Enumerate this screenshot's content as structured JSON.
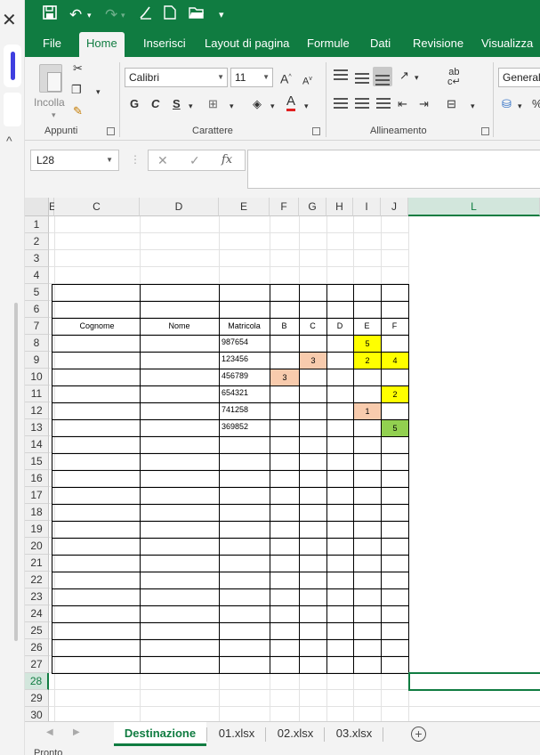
{
  "titlebar": {
    "more_label": "▾"
  },
  "tabs": [
    "File",
    "Home",
    "Inserisci",
    "Layout di pagina",
    "Formule",
    "Dati",
    "Revisione",
    "Visualizza"
  ],
  "ribbon": {
    "paste_label": "Incolla",
    "font_name": "Calibri",
    "font_size": "11",
    "number_format": "Generale",
    "groups": [
      "Appunti",
      "Carattere",
      "Allineamento"
    ]
  },
  "formula_bar": {
    "name_box": "L28",
    "fx_label": "fx",
    "formula": ""
  },
  "columns": [
    "E",
    "C",
    "D",
    "E",
    "F",
    "G",
    "H",
    "I",
    "J",
    "L"
  ],
  "rows": [
    "1",
    "2",
    "3",
    "4",
    "5",
    "6",
    "7",
    "8",
    "9",
    "10",
    "11",
    "12",
    "13",
    "14",
    "15",
    "16",
    "17",
    "18",
    "19",
    "20",
    "21",
    "22",
    "23",
    "24",
    "25",
    "26",
    "27",
    "28",
    "29",
    "30"
  ],
  "table": {
    "headers": [
      "Cognome",
      "Nome",
      "Matricola",
      "B",
      "C",
      "D",
      "E",
      "F"
    ],
    "matricole": [
      "987654",
      "123456",
      "456789",
      "654321",
      "741258",
      "369852"
    ],
    "values": [
      {
        "row": 8,
        "col": "I",
        "value": "5",
        "fill": "#ffff00"
      },
      {
        "row": 9,
        "col": "G",
        "value": "3",
        "fill": "#f8cbad"
      },
      {
        "row": 9,
        "col": "I",
        "value": "2",
        "fill": "#ffff00"
      },
      {
        "row": 9,
        "col": "J",
        "value": "4",
        "fill": "#ffff00"
      },
      {
        "row": 10,
        "col": "F",
        "value": "3",
        "fill": "#f8cbad"
      },
      {
        "row": 11,
        "col": "J",
        "value": "2",
        "fill": "#ffff00"
      },
      {
        "row": 12,
        "col": "I",
        "value": "1",
        "fill": "#f8cbad"
      },
      {
        "row": 13,
        "col": "J",
        "value": "5",
        "fill": "#92d050"
      }
    ]
  },
  "sheet_tabs": [
    "Destinazione",
    "01.xlsx",
    "02.xlsx",
    "03.xlsx"
  ],
  "add_sheet_label": "+",
  "status": "Pronto",
  "colors": {
    "accent": "#107c41",
    "yellow": "#ffff00",
    "salmon": "#f8cbad",
    "green": "#92d050"
  }
}
